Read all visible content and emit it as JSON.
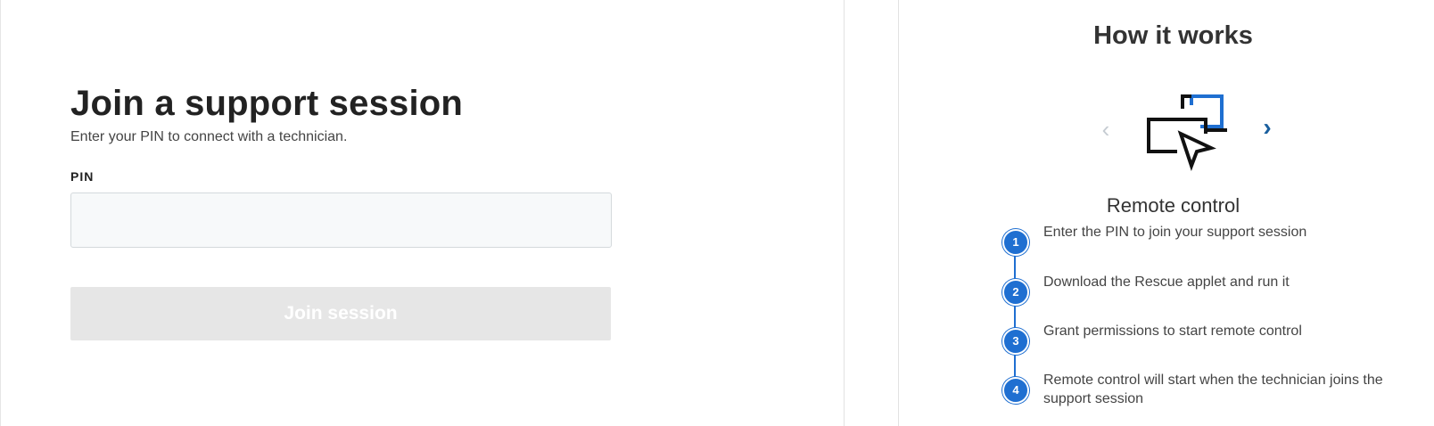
{
  "join": {
    "title": "Join a support session",
    "subtitle": "Enter your PIN to connect with a technician.",
    "pin_label": "PIN",
    "pin_value": "",
    "pin_placeholder": "",
    "button_label": "Join session"
  },
  "how_it_works": {
    "title": "How it works",
    "prev_glyph": "‹",
    "next_glyph": "›",
    "slide": {
      "caption": "Remote control",
      "icon": "remote-control-icon"
    },
    "steps": [
      {
        "number": "1",
        "text": "Enter the PIN to join your support session"
      },
      {
        "number": "2",
        "text": "Download the Rescue applet and run it"
      },
      {
        "number": "3",
        "text": "Grant permissions to start remote control"
      },
      {
        "number": "4",
        "text": "Remote control will start when the technician joins the support session"
      }
    ]
  },
  "colors": {
    "accent": "#1f6fd1",
    "nav_active": "#1a5f9e",
    "nav_disabled": "#c6ccd2",
    "button_disabled_bg": "#e6e6e6",
    "input_bg": "#f7f9fa"
  }
}
